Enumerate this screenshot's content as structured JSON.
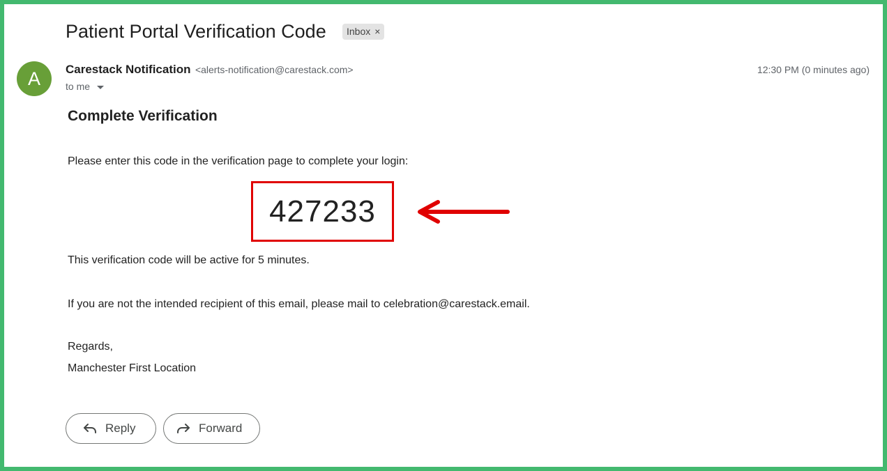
{
  "email": {
    "subject": "Patient Portal Verification Code",
    "label": "Inbox",
    "label_remove": "×",
    "avatar_letter": "A",
    "sender_name": "Carestack Notification",
    "sender_email": "<alerts-notification@carestack.com>",
    "timestamp": "12:30 PM (0 minutes ago)",
    "to": "to me"
  },
  "body": {
    "title": "Complete Verification",
    "instruction": "Please enter this code in the verification page to complete your login:",
    "code": "427233",
    "active_note": "This verification code will be active for 5 minutes.",
    "recipient_note": "If you are not the intended recipient of this email, please mail to celebration@carestack.email.",
    "regards": "Regards,",
    "signature": "Manchester First Location"
  },
  "actions": {
    "reply_label": "Reply",
    "forward_label": "Forward"
  },
  "colors": {
    "frame_border": "#43b96f",
    "avatar_bg": "#689f38",
    "highlight": "#e00000"
  },
  "icons": {
    "reply": "reply-icon",
    "forward": "forward-icon",
    "annotation_arrow": "red-left-arrow-icon",
    "dropdown": "caret-down-icon"
  }
}
